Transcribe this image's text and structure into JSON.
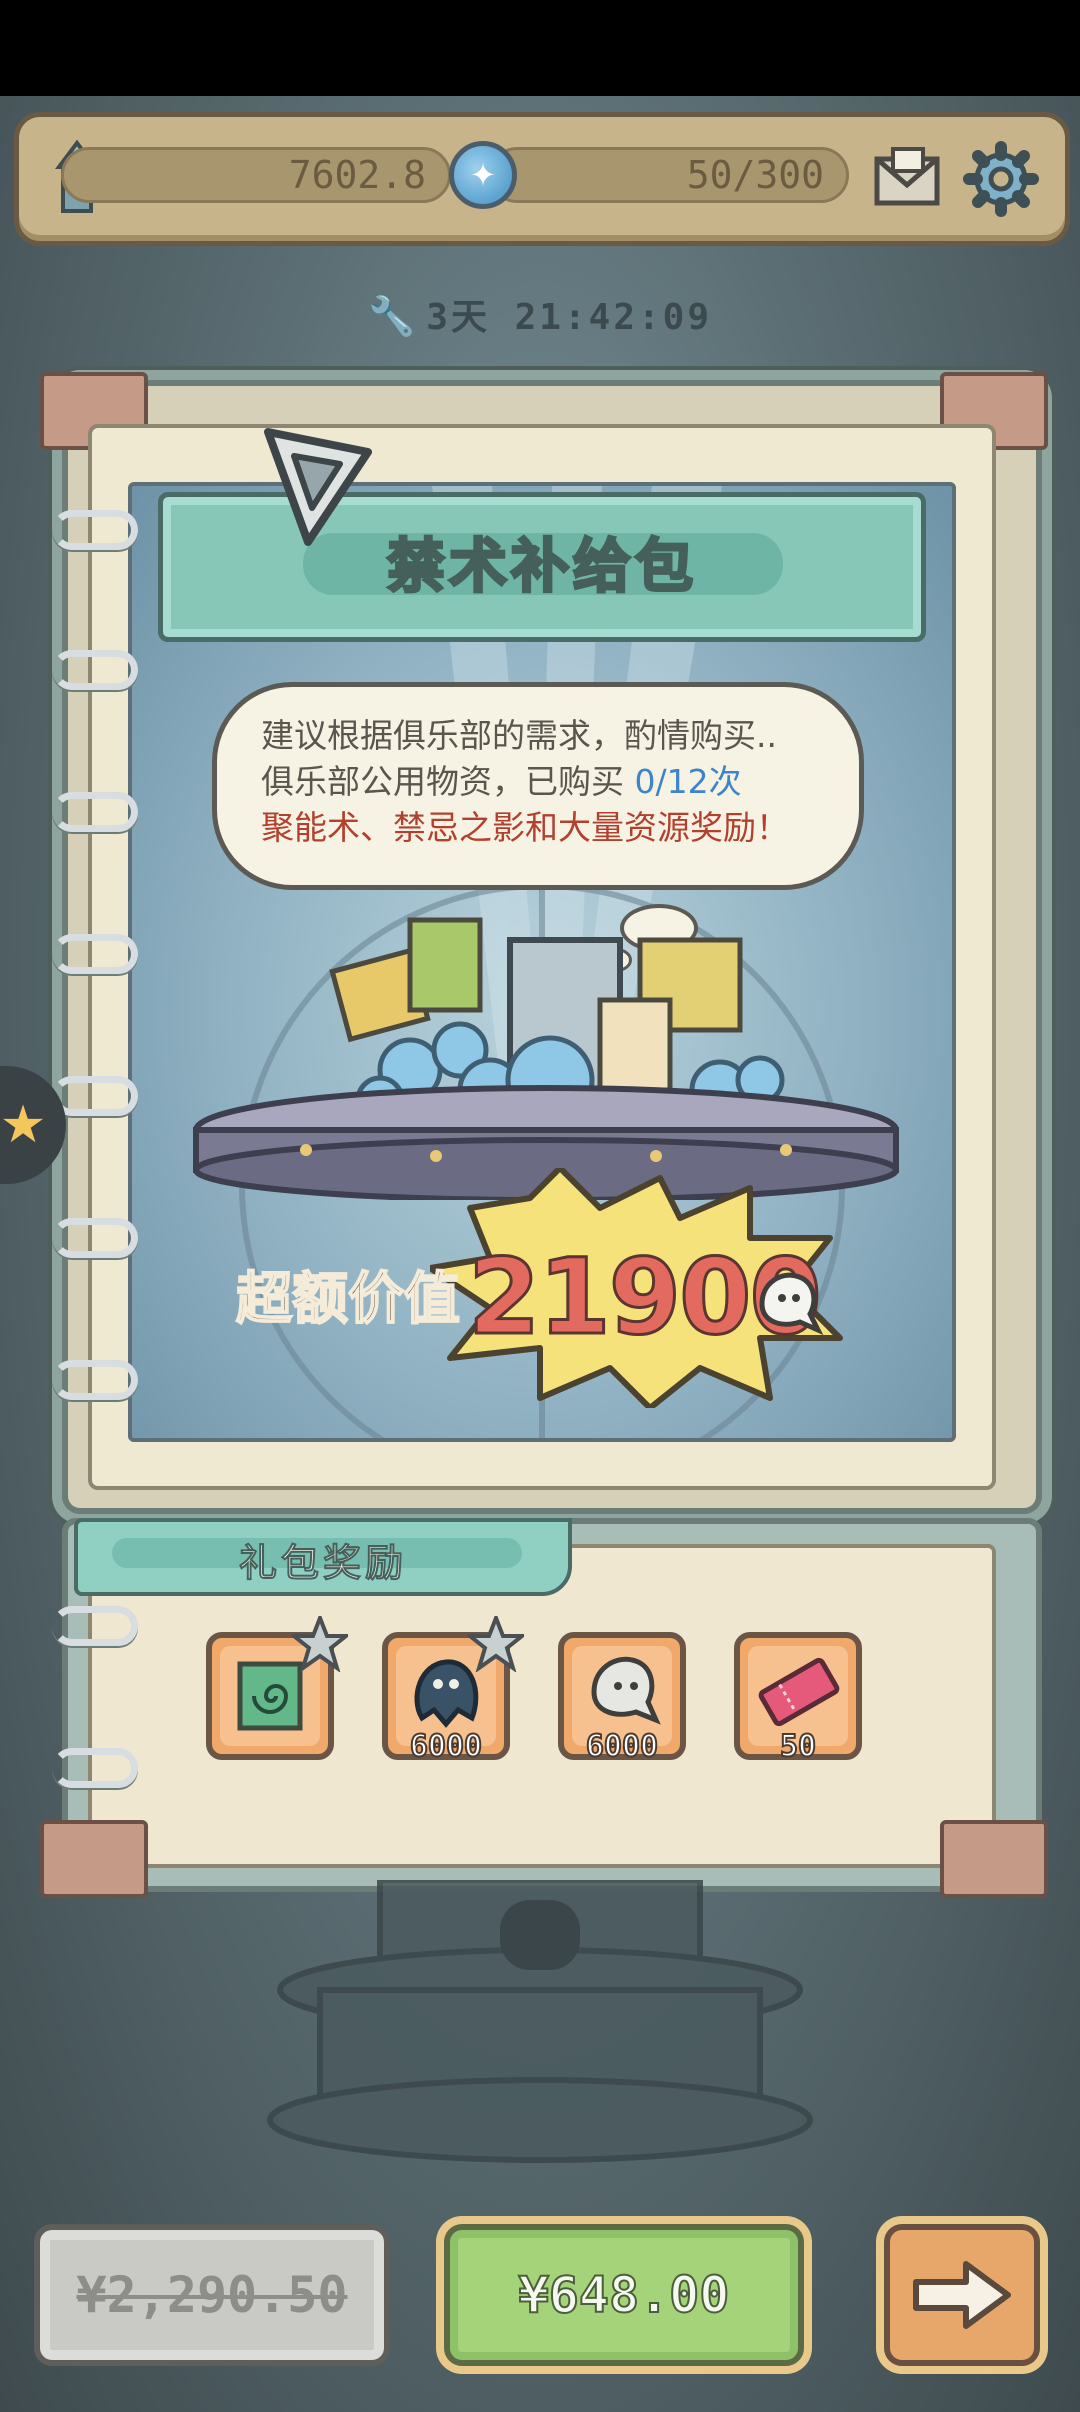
{
  "topbar": {
    "tower_value": "7602.8",
    "coin_value": "50/300",
    "icons": [
      "tower-icon",
      "coin-icon",
      "mail-icon",
      "gear-icon"
    ]
  },
  "timer": {
    "text": "3天 21:42:09",
    "icon": "wrench-icon"
  },
  "pack": {
    "title": "禁术补给包",
    "bubble_line1": "建议根据俱乐部的需求，酌情购买..",
    "bubble_line2_prefix": "俱乐部公用物资，已购买 ",
    "bubble_line2_count": "0/12次",
    "bubble_line3": "聚能术、禁忌之影和大量资源奖励！",
    "value_label": "超额价值",
    "value_number": "21900"
  },
  "rewards": {
    "title": "礼包奖励",
    "items": [
      {
        "icon": "vortex-scroll-icon",
        "count": ""
      },
      {
        "icon": "shadow-creature-icon",
        "count": "6000"
      },
      {
        "icon": "ghost-icon",
        "count": "6000"
      },
      {
        "icon": "ticket-icon",
        "count": "50"
      }
    ]
  },
  "buttons": {
    "original_price": "¥2,290.50",
    "buy_price": "¥648.00",
    "next_icon": "arrow-right-icon"
  },
  "colors": {
    "accent_green": "#a4d37a",
    "value_red": "#e36a5f",
    "count_blue": "#3f84c9",
    "reward_text_red": "#b3402e"
  }
}
